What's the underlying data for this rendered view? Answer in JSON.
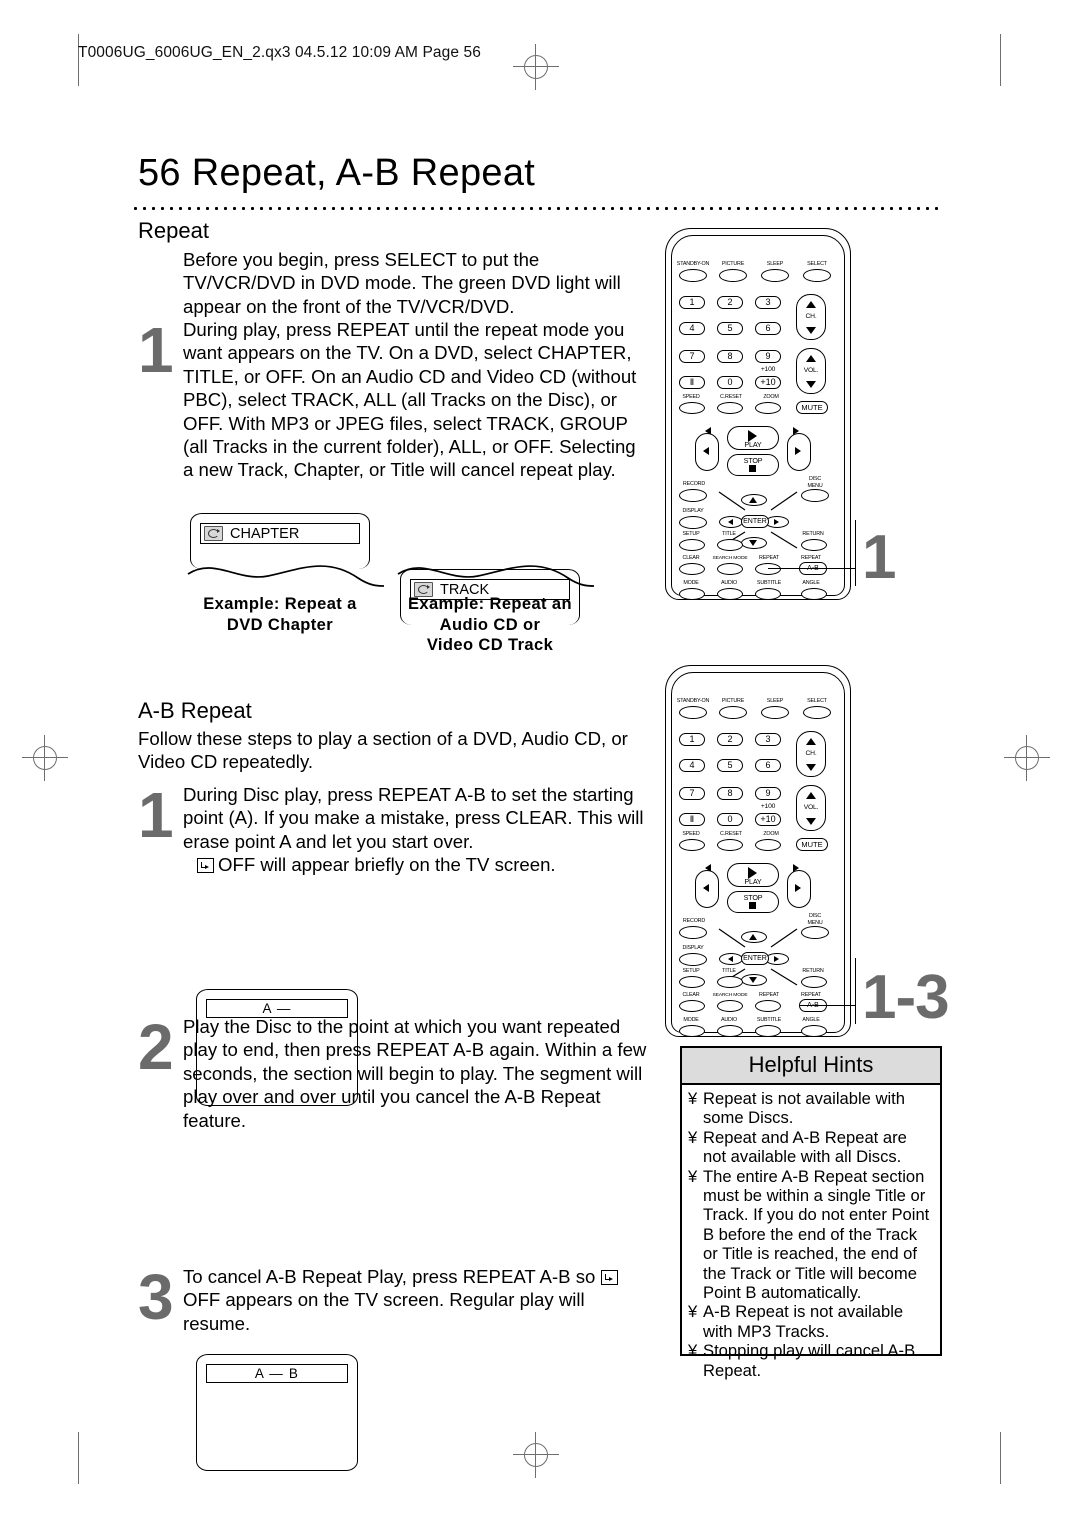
{
  "page": {
    "file_header": "T0006UG_6006UG_EN_2.qx3  04.5.12  10:09 AM  Page 56",
    "title": "56  Repeat, A-B Repeat"
  },
  "repeat_section": {
    "heading": "Repeat",
    "intro": "Before you begin, press SELECT  to put the TV/VCR/DVD in DVD mode. The green DVD light will appear on the front of the TV/VCR/DVD.",
    "step1_number": "1",
    "step1_text": "During play, press REPEAT until the repeat mode you want appears  on the TV. On a DVD, select CHAPTER, TITLE, or OFF. On an Audio CD and Video CD (without PBC), select TRACK, ALL (all Tracks on the Disc), or OFF. With MP3 or JPEG files, select TRACK, GROUP (all Tracks in the current folder), ALL, or OFF. Selecting a new Track, Chapter, or Title will cancel repeat play.",
    "screens": [
      {
        "icon": "repeat-icon",
        "label": "CHAPTER",
        "caption": "Example: Repeat a\nDVD Chapter"
      },
      {
        "icon": "repeat-icon",
        "label": "TRACK",
        "caption": "Example: Repeat an\nAudio CD or\nVideo CD Track"
      }
    ]
  },
  "ab_section": {
    "heading": "A-B Repeat",
    "intro": "Follow these steps to play a section of a DVD, Audio CD, or Video CD repeatedly.",
    "steps": [
      {
        "number": "1",
        "text": "During Disc play, press REPEAT A-B to set the starting point (A).    If you make a mistake, press CLEAR. This will erase point A and let you start over.",
        "text_icon_line": "OFF will appear briefly on the TV screen.",
        "screen_label": "A —"
      },
      {
        "number": "2",
        "text": "Play the Disc to the point at which you want repeated play to end, then press REPEAT A-B again. Within a few seconds, the section will begin to play. The segment will play over and over until you cancel the A-B Repeat feature.",
        "screen_label": "A — B"
      },
      {
        "number": "3",
        "text_before_icon": "To  cancel A-B Repeat Play, press REPEAT A-B so",
        "text_after_icon": "OFF appears on the TV screen.   Regular play will resume."
      }
    ]
  },
  "hints": {
    "title": "Helpful Hints",
    "bullet": "¥",
    "items": [
      "Repeat is not available with some Discs.",
      "Repeat and A-B Repeat are not available with all Discs.",
      "The entire A-B Repeat section must be within a single Title or Track. If you do not enter Point B before the end of the Track or Title is reached, the end of the Track or Title will become Point B automatically.",
      "A-B Repeat is not available with MP3 Tracks.",
      "Stopping play will cancel A-B Repeat."
    ]
  },
  "remote": {
    "callout_top": "1",
    "callout_bottom": "1-3",
    "top_row": [
      "STANDBY-ON",
      "PICTURE",
      "SLEEP",
      "SELECT"
    ],
    "keypad": [
      "1",
      "2",
      "3",
      "4",
      "5",
      "6",
      "7",
      "8",
      "9"
    ],
    "key_pause": "Ⅱ",
    "key_zero": "0",
    "key_plus10": "+10",
    "key_plus100": "+100",
    "rocker_ch": "CH.",
    "rocker_vol": "VOL.",
    "fn_row": [
      "SPEED",
      "C.RESET",
      "ZOOM"
    ],
    "mute": "MUTE",
    "play": "PLAY",
    "stop": "STOP",
    "record": "RECORD",
    "disc_menu": "DISC\nMENU",
    "display": "DISPLAY",
    "enter": "ENTER",
    "setup_row": [
      "SETUP",
      "TITLE",
      "RETURN"
    ],
    "clear_row": [
      "CLEAR",
      "SEARCH MODE",
      "REPEAT",
      "REPEAT"
    ],
    "repeat_ab": "A-B",
    "mode_row": [
      "MODE",
      "AUDIO",
      "SUBTITLE",
      "ANGLE"
    ]
  }
}
